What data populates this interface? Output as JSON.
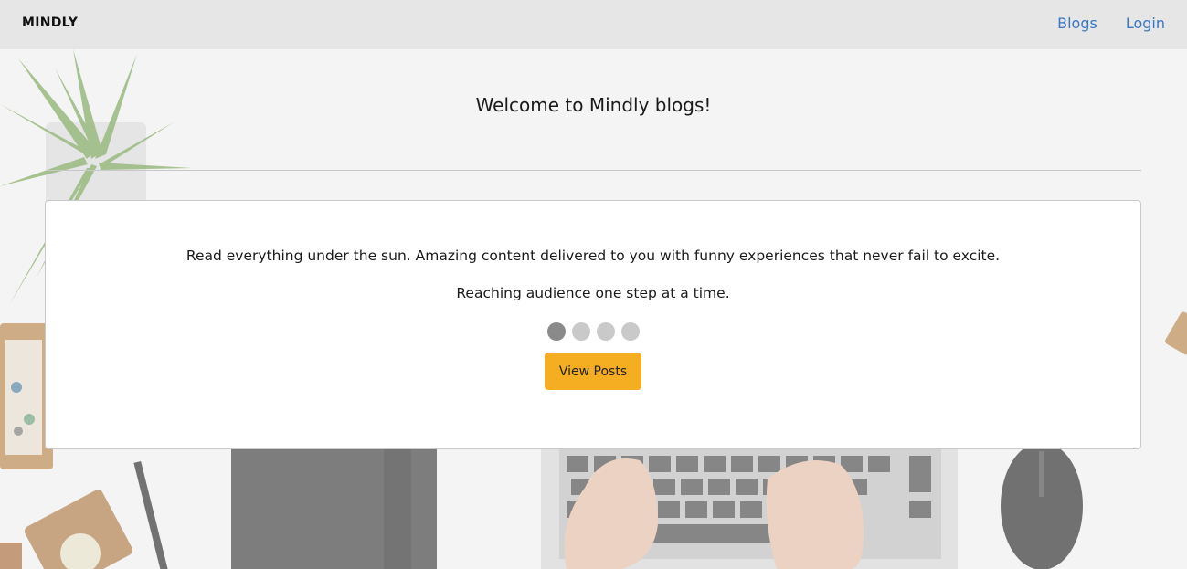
{
  "header": {
    "brand": "MINDLY",
    "nav": [
      {
        "label": "Blogs"
      },
      {
        "label": "Login"
      }
    ]
  },
  "hero": {
    "title": "Welcome to Mindly blogs!",
    "carousel": {
      "lines": [
        "Read everything under the sun. Amazing content delivered to you with funny experiences that never fail to excite.",
        "Reaching audience one step at a time."
      ],
      "slide_count": 4,
      "active_slide": 1
    },
    "cta_label": "View Posts"
  },
  "colors": {
    "navbar_bg": "#e6e6e6",
    "link": "#3a78c3",
    "cta": "#f5ae22",
    "dot_active": "#8a8a8a",
    "dot_inactive": "#c9c9c9"
  },
  "icons": [
    "brand-logo"
  ]
}
